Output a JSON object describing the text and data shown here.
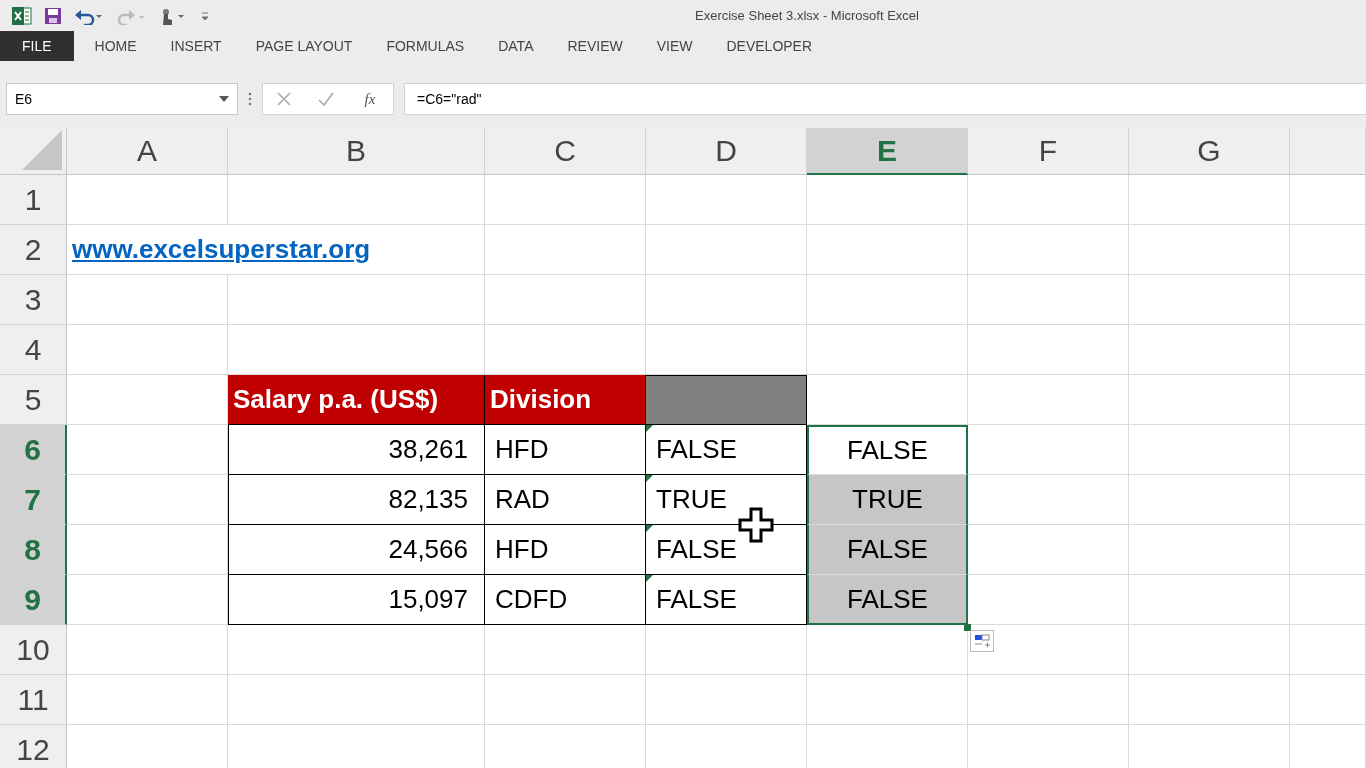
{
  "window": {
    "title": "Exercise Sheet 3.xlsx - Microsoft Excel"
  },
  "ribbon_tabs": [
    {
      "label": "FILE",
      "selected": true
    },
    {
      "label": "HOME",
      "selected": false
    },
    {
      "label": "INSERT",
      "selected": false
    },
    {
      "label": "PAGE LAYOUT",
      "selected": false
    },
    {
      "label": "FORMULAS",
      "selected": false
    },
    {
      "label": "DATA",
      "selected": false
    },
    {
      "label": "REVIEW",
      "selected": false
    },
    {
      "label": "VIEW",
      "selected": false
    },
    {
      "label": "DEVELOPER",
      "selected": false
    }
  ],
  "formula_bar": {
    "name_box": "E6",
    "function_button": "fx",
    "formula": "=C6=\"rad\""
  },
  "columns": [
    {
      "label": "A",
      "selected": false
    },
    {
      "label": "B",
      "selected": false
    },
    {
      "label": "C",
      "selected": false
    },
    {
      "label": "D",
      "selected": false
    },
    {
      "label": "E",
      "selected": true
    },
    {
      "label": "F",
      "selected": false
    },
    {
      "label": "G",
      "selected": false
    }
  ],
  "rows": [
    {
      "label": "1",
      "selected": false,
      "cells": []
    },
    {
      "label": "2",
      "selected": false,
      "cells": [
        {
          "kind": "link",
          "text": "www.excelsuperstar.org"
        }
      ]
    },
    {
      "label": "3",
      "selected": false,
      "cells": []
    },
    {
      "label": "4",
      "selected": false,
      "cells": []
    },
    {
      "label": "5",
      "selected": false,
      "cells": [
        {
          "kind": "blank"
        },
        {
          "kind": "header",
          "text": "Salary p.a. (US$)"
        },
        {
          "kind": "header",
          "text": "Division"
        },
        {
          "kind": "header-empty"
        }
      ]
    },
    {
      "label": "6",
      "selected": true,
      "cells": [
        {
          "kind": "blank"
        },
        {
          "kind": "number",
          "text": "38,261"
        },
        {
          "kind": "text",
          "text": "HFD"
        },
        {
          "kind": "text",
          "text": "FALSE",
          "flag": true
        },
        {
          "kind": "result",
          "text": "FALSE",
          "selected": true,
          "active": true
        }
      ]
    },
    {
      "label": "7",
      "selected": true,
      "cells": [
        {
          "kind": "blank"
        },
        {
          "kind": "number",
          "text": "82,135"
        },
        {
          "kind": "text",
          "text": "RAD"
        },
        {
          "kind": "text",
          "text": "TRUE",
          "flag": true
        },
        {
          "kind": "result",
          "text": "TRUE",
          "selected": true,
          "active": false
        }
      ]
    },
    {
      "label": "8",
      "selected": true,
      "cells": [
        {
          "kind": "blank"
        },
        {
          "kind": "number",
          "text": "24,566"
        },
        {
          "kind": "text",
          "text": "HFD"
        },
        {
          "kind": "text",
          "text": "FALSE",
          "flag": true
        },
        {
          "kind": "result",
          "text": "FALSE",
          "selected": true,
          "active": false
        }
      ]
    },
    {
      "label": "9",
      "selected": true,
      "cells": [
        {
          "kind": "blank"
        },
        {
          "kind": "number",
          "text": "15,097"
        },
        {
          "kind": "text",
          "text": "CDFD"
        },
        {
          "kind": "text",
          "text": "FALSE",
          "flag": true
        },
        {
          "kind": "result",
          "text": "FALSE",
          "selected": true,
          "active": false
        }
      ]
    },
    {
      "label": "10",
      "selected": false,
      "cells": []
    },
    {
      "label": "11",
      "selected": false,
      "cells": []
    },
    {
      "label": "12",
      "selected": false,
      "cells": []
    }
  ]
}
